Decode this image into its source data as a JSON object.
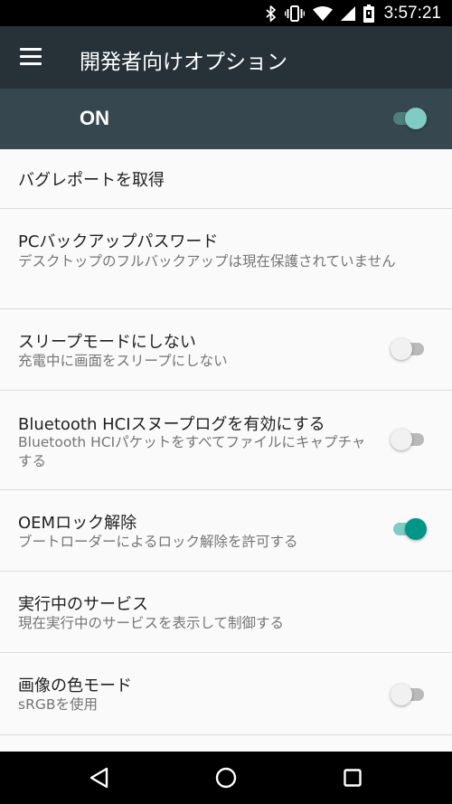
{
  "status_bar": {
    "time": "3:57:21",
    "icons": [
      "bluetooth-icon",
      "vibrate-icon",
      "wifi-icon",
      "cellular-signal-icon",
      "battery-icon"
    ]
  },
  "app_bar": {
    "menu_icon": "hamburger-menu-icon",
    "title": "開発者向けオプション",
    "background": "#263238"
  },
  "master_switch": {
    "label": "ON",
    "checked": true,
    "background": "#37474f"
  },
  "settings": [
    {
      "title": "バグレポートを取得"
    },
    {
      "title": "PCバックアップパスワード",
      "summary": "デスクトップのフルバックアップは現在保護されていません"
    },
    {
      "title": "スリープモードにしない",
      "summary": "充電中に画面をスリープにしない",
      "toggle": false
    },
    {
      "title": "Bluetooth HCIスヌープログを有効にする",
      "summary": "Bluetooth HCIパケットをすべてファイルにキャプチャする",
      "toggle": false
    },
    {
      "title": "OEMロック解除",
      "summary": "ブートローダーによるロック解除を許可する",
      "toggle": true
    },
    {
      "title": "実行中のサービス",
      "summary": "現在実行中のサービスを表示して制御する"
    },
    {
      "title": "画像の色モード",
      "summary": "sRGBを使用",
      "toggle": false
    }
  ],
  "accent_color": "#009688",
  "nav_bar": {
    "buttons": [
      "back-icon",
      "home-icon",
      "recents-icon"
    ]
  }
}
